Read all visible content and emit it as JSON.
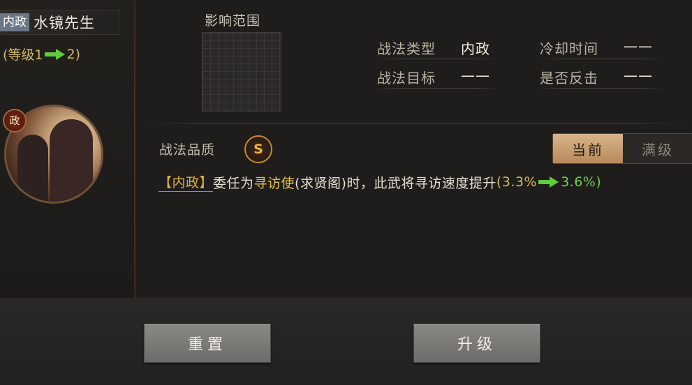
{
  "hero": {
    "type_tag": "内政",
    "name": "水镜先生",
    "level_prefix": "(等级1",
    "level_to": "2)",
    "badge": "政"
  },
  "influence": {
    "title": "影响范围"
  },
  "attributes": [
    {
      "key": "战法类型",
      "value": "内政"
    },
    {
      "key": "冷却时间",
      "value": "——"
    },
    {
      "key": "战法目标",
      "value": "——"
    },
    {
      "key": "是否反击",
      "value": "——"
    }
  ],
  "quality": {
    "label": "战法品质",
    "grade": "S"
  },
  "toggle": {
    "current": "当前",
    "max": "满级",
    "selected": "current"
  },
  "description": {
    "tag": "【内政】",
    "part1": "委任为",
    "emphasis": "寻访使",
    "part2": "(求贤阁)时，此武将寻访速度提升",
    "pct_open": "(3.3%",
    "pct_new": "3.6%)"
  },
  "buttons": {
    "reset": "重置",
    "upgrade": "升级"
  },
  "colors": {
    "accent_gold": "#d6b95c",
    "arrow_green": "#5fcb3d",
    "quality_s": "#f0b13b"
  }
}
